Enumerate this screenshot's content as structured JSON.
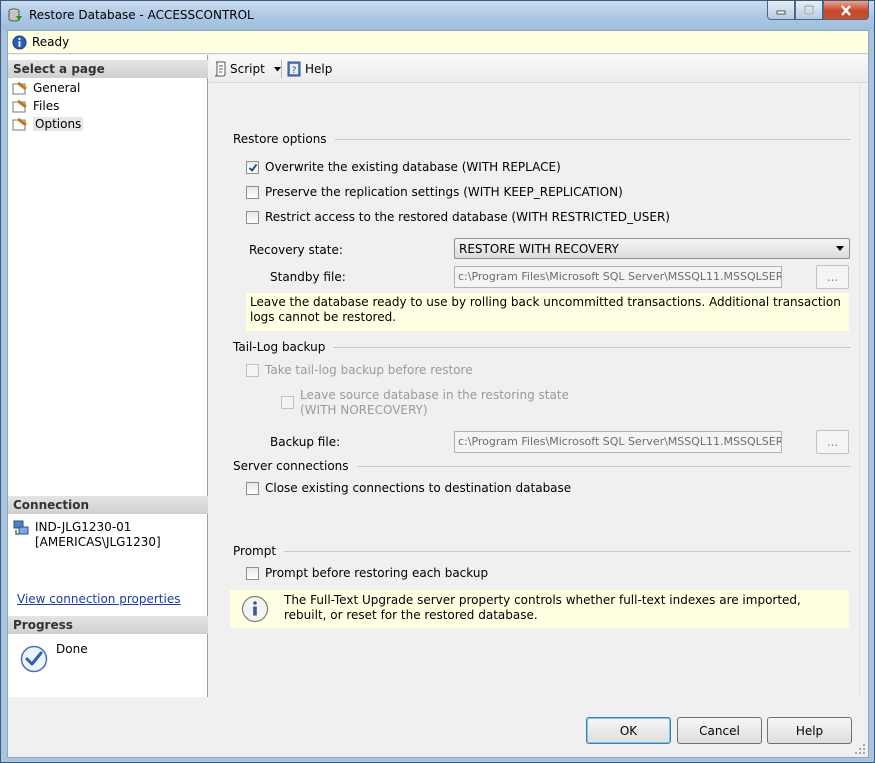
{
  "window": {
    "title": "Restore Database - ACCESSCONTROL"
  },
  "status": {
    "text": "Ready"
  },
  "left": {
    "select_page_header": "Select a page",
    "pages": [
      {
        "label": "General"
      },
      {
        "label": "Files"
      },
      {
        "label": "Options",
        "selected": true
      }
    ],
    "connection_header": "Connection",
    "server": "IND-JLG1230-01",
    "user": "[AMERICAS\\JLG1230]",
    "view_connection_link": "View connection properties",
    "progress_header": "Progress",
    "progress_status": "Done"
  },
  "toolbar": {
    "script_label": "Script",
    "help_label": "Help"
  },
  "restore_options": {
    "title": "Restore options",
    "overwrite": {
      "label": "Overwrite the existing database (WITH REPLACE)",
      "checked": true
    },
    "preserve_replication": {
      "label": "Preserve the replication settings (WITH KEEP_REPLICATION)",
      "checked": false
    },
    "restrict_access": {
      "label": "Restrict access to the restored database (WITH RESTRICTED_USER)",
      "checked": false
    },
    "recovery_state_label": "Recovery state:",
    "recovery_state_value": "RESTORE WITH RECOVERY",
    "standby_label": "Standby file:",
    "standby_value": "c:\\Program Files\\Microsoft SQL Server\\MSSQL11.MSSQLSERVER\\MSSQL\\Backup\\ACCESSCONTROL_RollbackUndo.bak",
    "browse_label": "...",
    "info": "Leave the database ready to use by rolling back uncommitted transactions. Additional transaction logs cannot be restored."
  },
  "tail_log": {
    "title": "Tail-Log backup",
    "take_backup": {
      "label": "Take tail-log backup before restore",
      "checked": false
    },
    "leave_source_line1": "Leave source database in the restoring state",
    "leave_source_line2": "(WITH NORECOVERY)",
    "backup_file_label": "Backup file:",
    "backup_file_value": "c:\\Program Files\\Microsoft SQL Server\\MSSQL11.MSSQLSERVER\\MSSQL\\Backup\\ACCESSCONTROL_LogBackup.bak",
    "browse_label": "..."
  },
  "server_connections": {
    "title": "Server connections",
    "close_connections": {
      "label": "Close existing connections to destination database",
      "checked": false
    }
  },
  "prompt": {
    "title": "Prompt",
    "prompt_each": {
      "label": "Prompt before restoring each backup",
      "checked": false
    },
    "info": "The Full-Text Upgrade server property controls whether full-text indexes are imported, rebuilt, or reset for the restored database."
  },
  "buttons": {
    "ok": "OK",
    "cancel": "Cancel",
    "help": "Help"
  }
}
